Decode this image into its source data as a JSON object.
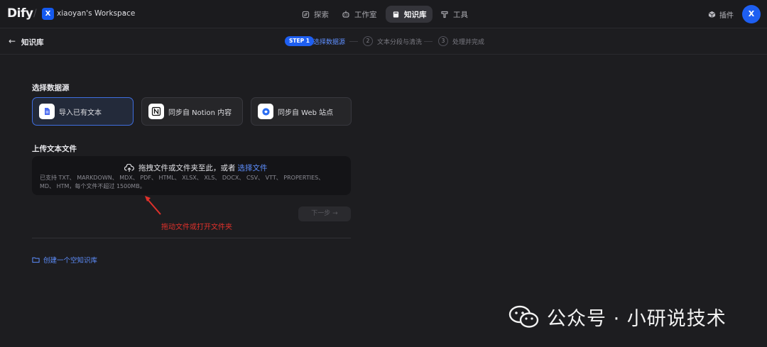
{
  "app": {
    "logo": "Dify"
  },
  "workspace": {
    "badge": "X",
    "name": "xiaoyan's Workspace",
    "chevron": "⌄"
  },
  "nav": {
    "explore": "探索",
    "studio": "工作室",
    "knowledge": "知识库",
    "tools": "工具"
  },
  "header_right": {
    "plugins": "插件",
    "avatar": "X"
  },
  "subbar": {
    "back_icon": "←",
    "breadcrumb": "知识库",
    "steps": [
      {
        "badge": "STEP 1",
        "label": "选择数据源"
      },
      {
        "num": "2",
        "label": "文本分段与清洗"
      },
      {
        "num": "3",
        "label": "处理并完成"
      }
    ]
  },
  "datasource": {
    "title": "选择数据源",
    "options": [
      {
        "label": "导入已有文本",
        "icon": "file-text-icon",
        "selected": true
      },
      {
        "label": "同步自 Notion 内容",
        "icon": "notion-icon",
        "selected": false
      },
      {
        "label": "同步自 Web 站点",
        "icon": "web-icon",
        "selected": false
      }
    ]
  },
  "upload": {
    "title": "上传文本文件",
    "drop_text": "拖拽文件或文件夹至此，或者",
    "choose_link": "选择文件",
    "supported_line1": "已支持 TXT、 MARKDOWN、 MDX、 PDF、 HTML、 XLSX、 XLS、 DOCX、 CSV、 VTT、 PROPERTIES、",
    "supported_line2": "MD、 HTM，每个文件不超过 1500MB。"
  },
  "next_button": "下一步 →",
  "annotation": "拖动文件或打开文件夹",
  "create_empty": "创建一个空知识库",
  "watermark": "公众号 · 小研说技术",
  "colors": {
    "accent": "#1e5ff2",
    "link": "#5e8fff",
    "annotation": "#e0312b",
    "background": "#1d1d20"
  }
}
